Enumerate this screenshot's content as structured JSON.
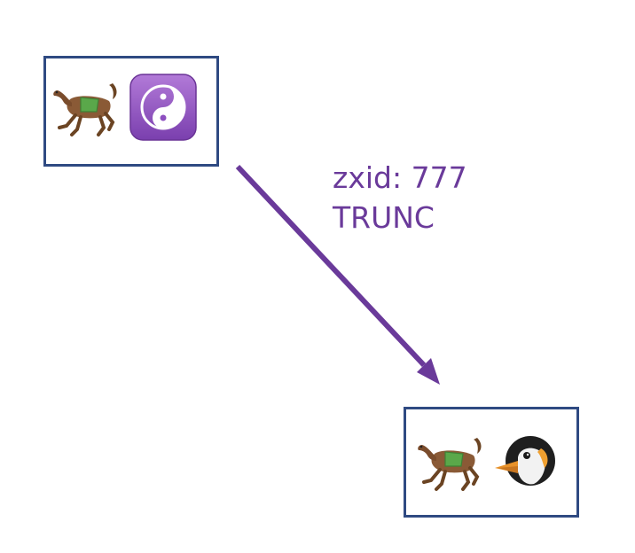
{
  "diagram": {
    "nodes": [
      {
        "id": "source",
        "icons": [
          "horse-racing-icon",
          "yin-yang-icon"
        ]
      },
      {
        "id": "target",
        "icons": [
          "horse-racing-icon",
          "penguin-icon"
        ]
      }
    ],
    "edge": {
      "from": "source",
      "to": "target",
      "zxid_label": "zxid: 777",
      "type_label": "TRUNC"
    }
  },
  "colors": {
    "node_border": "#2f4a82",
    "edge": "#6a3a9a",
    "label": "#6a3a9a"
  }
}
